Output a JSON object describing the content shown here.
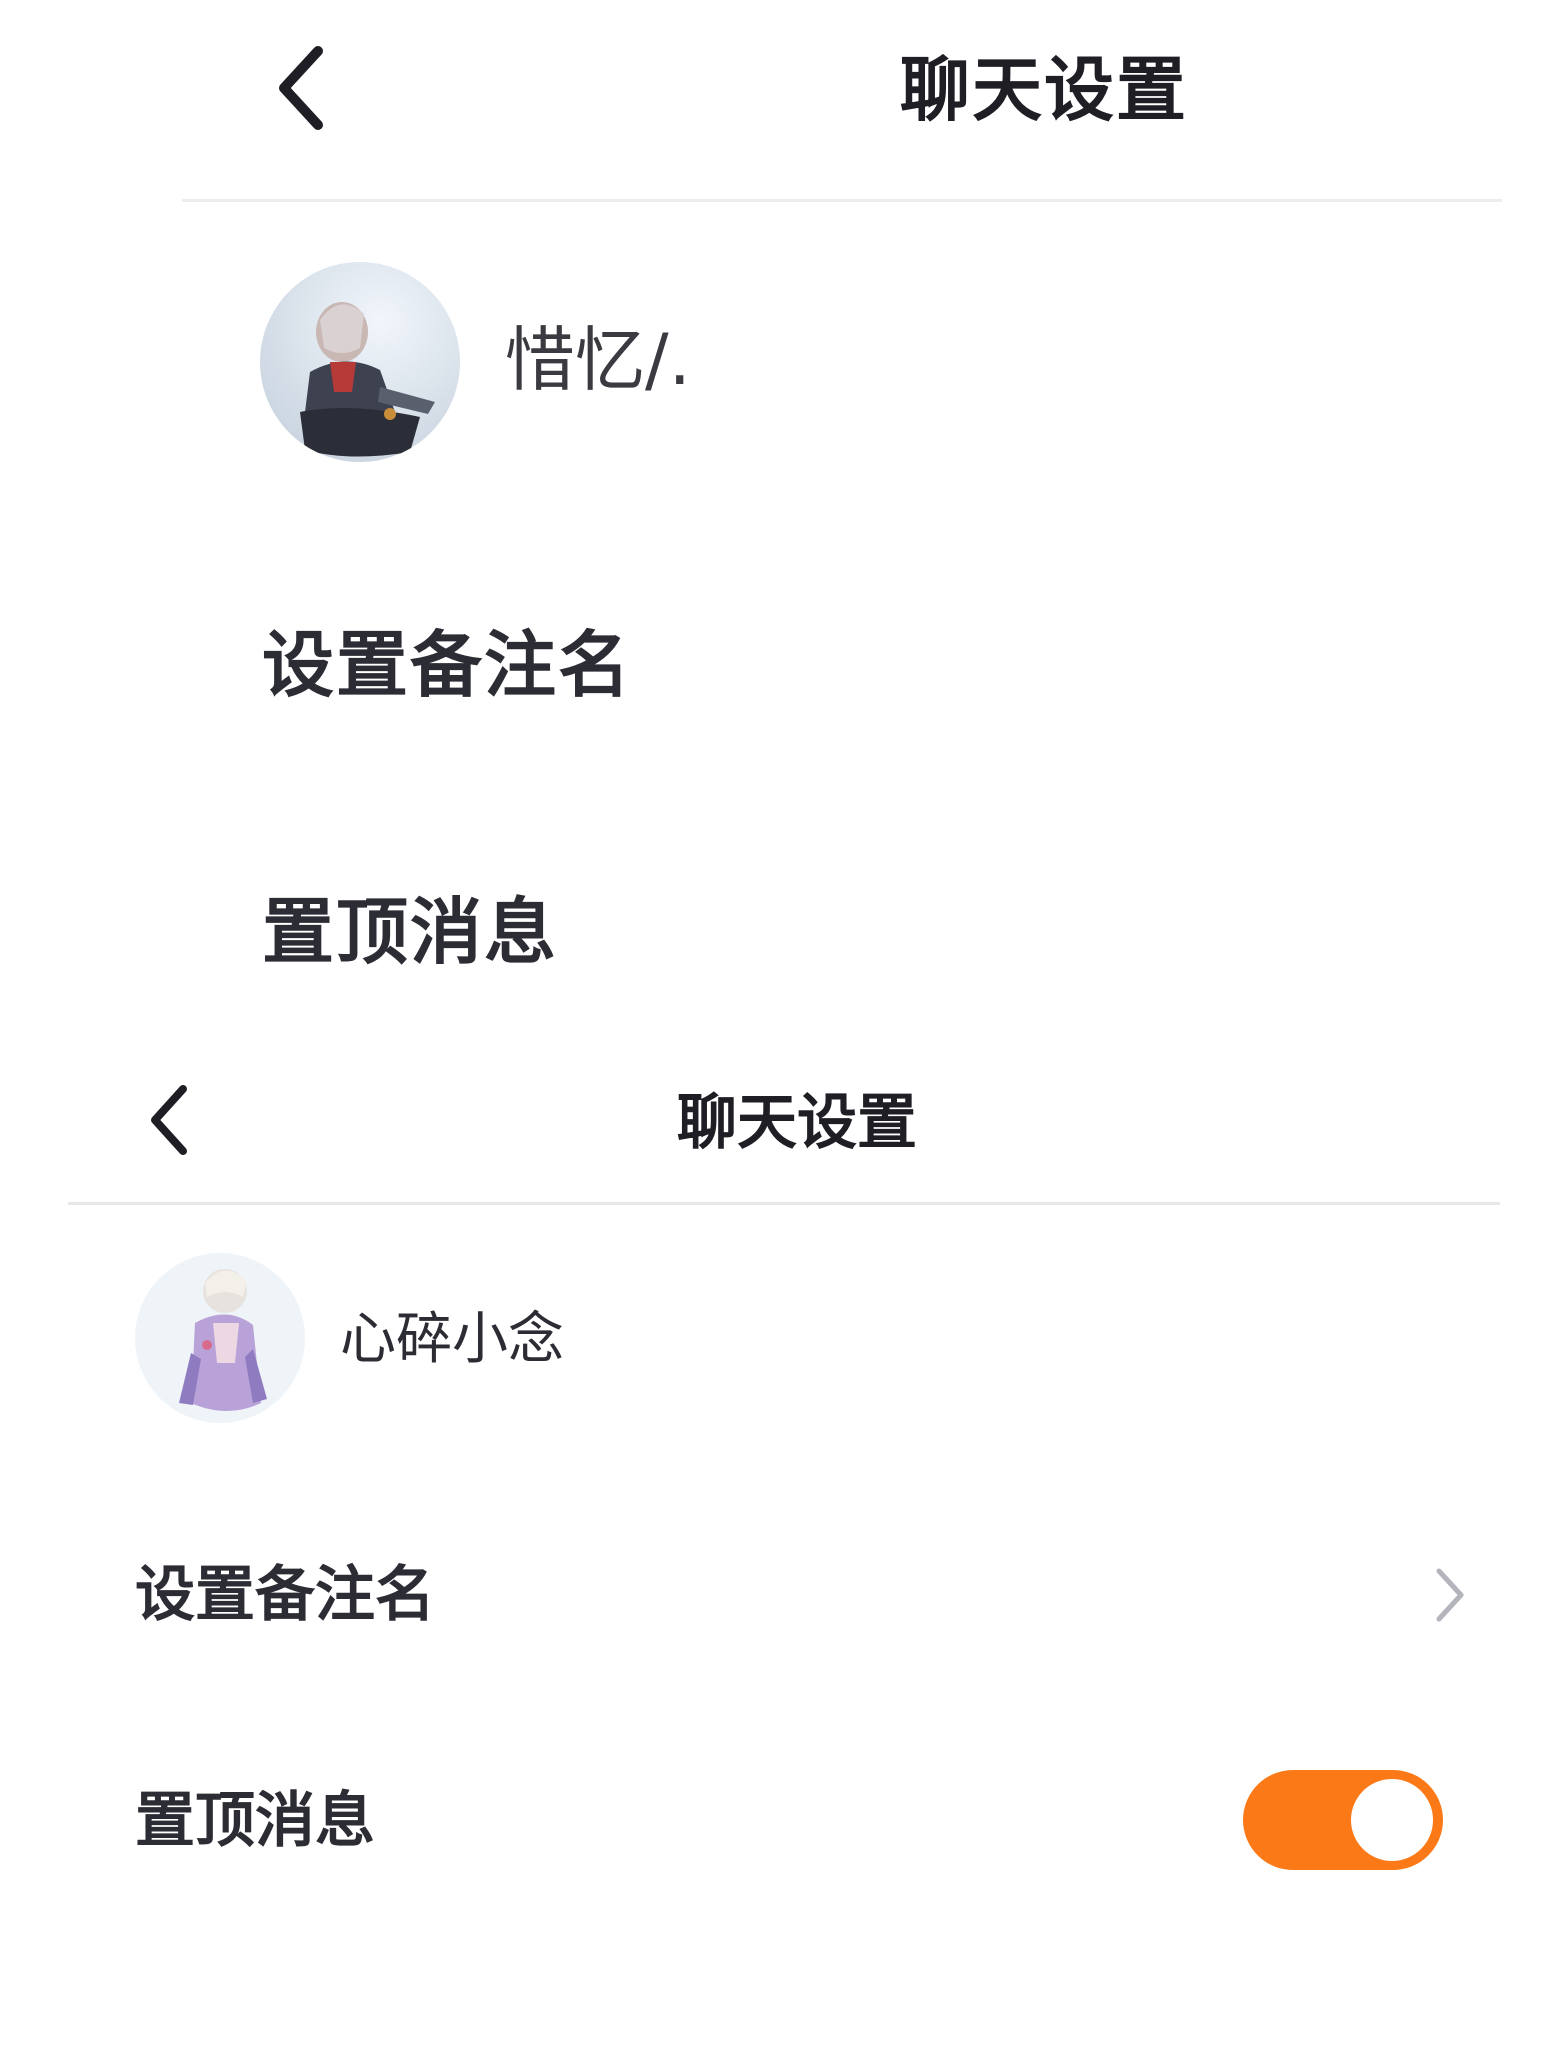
{
  "top_panel": {
    "header": {
      "title": "聊天设置",
      "back_icon": "chevron-left-icon"
    },
    "profile": {
      "username": "惜忆/.",
      "avatar": "avatar-anime-character"
    },
    "menu": {
      "remark_label": "设置备注名",
      "pin_label": "置顶消息"
    }
  },
  "bottom_panel": {
    "header": {
      "title": "聊天设置",
      "back_icon": "chevron-left-icon"
    },
    "profile": {
      "username": "心碎小念",
      "avatar": "avatar-anime-character"
    },
    "menu": {
      "remark_label": "设置备注名",
      "remark_icon": "chevron-right-icon",
      "pin_label": "置顶消息",
      "pin_enabled": true
    }
  },
  "colors": {
    "accent": "#fb7a17",
    "text": "#2c2c34",
    "divider": "#e7e7ea",
    "chevron": "#b4b4bc"
  }
}
